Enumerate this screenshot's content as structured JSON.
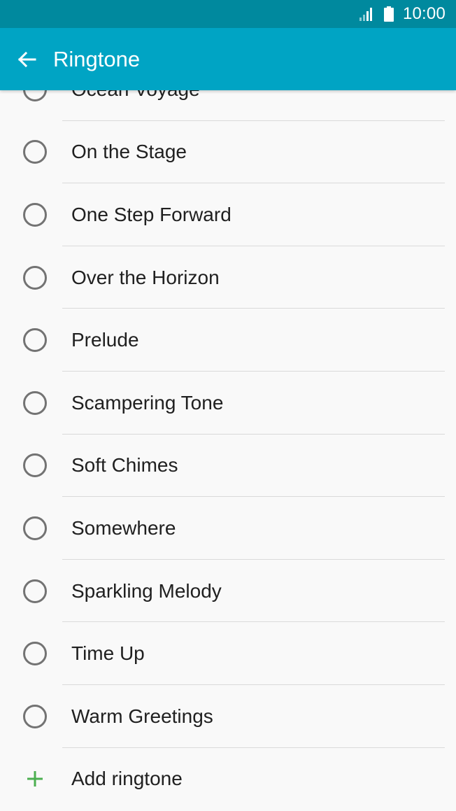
{
  "status_bar": {
    "time": "10:00",
    "icons": [
      "signal-icon",
      "battery-icon"
    ]
  },
  "app_bar": {
    "title": "Ringtone",
    "back_icon": "arrow-left-icon"
  },
  "ringtones": [
    "Ocean Voyage",
    "On the Stage",
    "One Step Forward",
    "Over the Horizon",
    "Prelude",
    "Scampering Tone",
    "Soft Chimes",
    "Somewhere",
    "Sparkling Melody",
    "Time Up",
    "Warm Greetings"
  ],
  "add_ringtone": {
    "label": "Add ringtone",
    "icon": "plus-icon"
  },
  "colors": {
    "status_bar": "#00899e",
    "app_bar": "#00a4c4",
    "background": "#f9f9f9",
    "radio_outline": "#737373",
    "add_icon": "#4caf50",
    "divider": "#dadada"
  }
}
